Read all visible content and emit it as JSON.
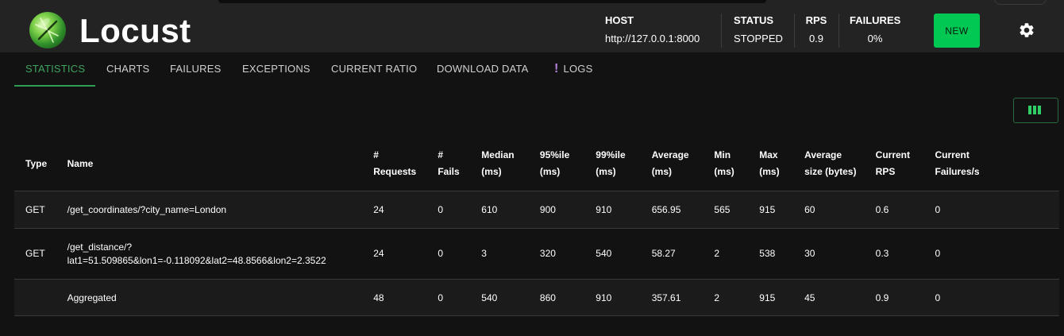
{
  "app": {
    "title": "Locust"
  },
  "header": {
    "host": {
      "label": "HOST",
      "value": "http://127.0.0.1:8000"
    },
    "status": {
      "label": "STATUS",
      "value": "STOPPED"
    },
    "rps": {
      "label": "RPS",
      "value": "0.9"
    },
    "failures": {
      "label": "FAILURES",
      "value": "0%"
    },
    "new_label": "NEW",
    "settings_icon": "gear-icon"
  },
  "tabs": [
    {
      "label": "STATISTICS",
      "active": true
    },
    {
      "label": "CHARTS"
    },
    {
      "label": "FAILURES"
    },
    {
      "label": "EXCEPTIONS"
    },
    {
      "label": "CURRENT RATIO"
    },
    {
      "label": "DOWNLOAD DATA"
    },
    {
      "label": "LOGS",
      "icon": "exclamation-icon"
    }
  ],
  "toolbar": {
    "columns_icon": "columns-icon"
  },
  "table": {
    "headers": [
      [
        "Type"
      ],
      [
        "Name"
      ],
      [
        "#",
        "Requests"
      ],
      [
        "#",
        "Fails"
      ],
      [
        "Median",
        "(ms)"
      ],
      [
        "95%ile",
        "(ms)"
      ],
      [
        "99%ile",
        "(ms)"
      ],
      [
        "Average",
        "(ms)"
      ],
      [
        "Min",
        "(ms)"
      ],
      [
        "Max",
        "(ms)"
      ],
      [
        "Average",
        "size (bytes)"
      ],
      [
        "Current",
        "RPS"
      ],
      [
        "Current",
        "Failures/s"
      ]
    ],
    "rows": [
      [
        "GET",
        "/get_coordinates/?city_name=London",
        "24",
        "0",
        "610",
        "900",
        "910",
        "656.95",
        "565",
        "915",
        "60",
        "0.6",
        "0"
      ],
      [
        "GET",
        "/get_distance/?",
        "24",
        "0",
        "3",
        "320",
        "540",
        "58.27",
        "2",
        "538",
        "30",
        "0.3",
        "0"
      ],
      [
        "",
        "Aggregated",
        "48",
        "0",
        "540",
        "860",
        "910",
        "357.61",
        "2",
        "915",
        "45",
        "0.9",
        "0"
      ]
    ],
    "row2_name_line2": "lat1=51.509865&lon1=-0.118092&lat2=48.8566&lon2=2.3522"
  },
  "colors": {
    "accent": "#00c853",
    "tab_active": "#3da35d",
    "logs_mark": "#b682d9"
  }
}
